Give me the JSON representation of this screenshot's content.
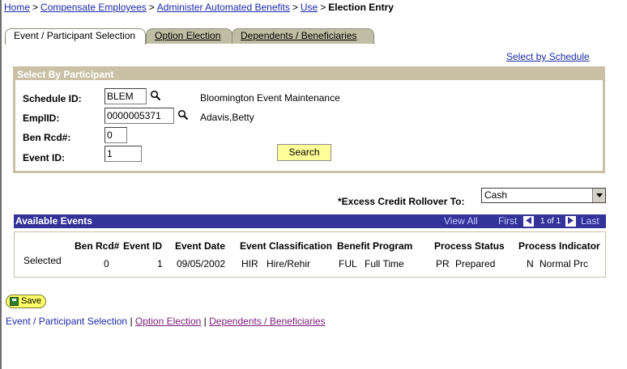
{
  "breadcrumb": {
    "items": [
      "Home",
      "Compensate Employees",
      "Administer Automated Benefits",
      "Use"
    ],
    "separator": ">",
    "current": "Election Entry"
  },
  "tabs": [
    {
      "label": "Event / Participant Selection",
      "active": true
    },
    {
      "label": "Option Election",
      "active": false
    },
    {
      "label": "Dependents / Beneficiaries",
      "active": false
    }
  ],
  "select_by_schedule_link": "Select by Schedule",
  "participant_panel": {
    "title": "Select By Participant",
    "schedule_id": {
      "label": "Schedule ID:",
      "value": "BLEM",
      "description": "Bloomington Event Maintenance"
    },
    "empl_id": {
      "label": "EmplID:",
      "value": "0000005371",
      "description": "Adavis,Betty"
    },
    "ben_rcd": {
      "label": "Ben Rcd#:",
      "value": "0"
    },
    "event_id": {
      "label": "Event ID:",
      "value": "1"
    },
    "search_label": "Search"
  },
  "rollover": {
    "label": "*Excess Credit Rollover To:",
    "value": "Cash"
  },
  "available_events": {
    "title": "Available Events",
    "view_all": "View All",
    "first": "First",
    "count": "1 of 1",
    "last": "Last",
    "columns": [
      "Ben Rcd#",
      "Event ID",
      "Event Date",
      "Event Classification",
      "Benefit Program",
      "Process Status",
      "Process Indicator"
    ],
    "row": {
      "selected": "Selected",
      "ben_rcd": "0",
      "event_id": "1",
      "event_date": "09/05/2002",
      "class_code": "HIR",
      "class_desc": "Hire/Rehir",
      "program_code": "FUL",
      "program_desc": "Full Time",
      "status_code": "PR",
      "status_desc": "Prepared",
      "indicator_code": "N",
      "indicator_desc": "Normal Prc"
    }
  },
  "save_label": "Save",
  "bottom_links": {
    "current": "Event / Participant Selection",
    "separator": "|",
    "links": [
      "Option Election",
      "Dependents / Beneficiaries"
    ]
  },
  "colors": {
    "link": "#1c2aa6",
    "grid_header": "#333399",
    "panel_border": "#c9c0a6",
    "tab_inactive": "#bfbea4",
    "button_yellow": "#ffff99"
  }
}
